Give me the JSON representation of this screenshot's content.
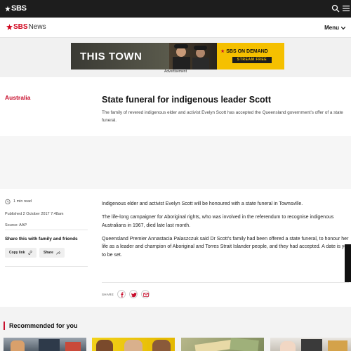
{
  "topbar": {
    "logo_text": "SBS",
    "icons": [
      "sbs-star-icon",
      "search-icon",
      "hamburger-icon"
    ]
  },
  "newsbar": {
    "logo_sbs": "SBS",
    "logo_news": "News",
    "menu_label": "Menu"
  },
  "advert": {
    "show_title": "THIS TOWN",
    "brand": "SBS ON DEMAND",
    "cta": "STREAM FREE",
    "label": "Advertisement",
    "colors": {
      "accent": "#f5c000"
    }
  },
  "article": {
    "category": "Australia",
    "headline": "State funeral for indigenous leader Scott",
    "standfirst": "The family of revered indigenous elder and activist Evelyn Scott has accepted the Queensland government's offer of a state funeral.",
    "read_time": "1 min read",
    "published": "Published 2 October 2017 7:48am",
    "source": "Source: AAP",
    "share_heading": "Share this with family and friends",
    "copy_link": "Copy link",
    "share": "Share",
    "paragraphs": [
      "Indigenous elder and activist Evelyn Scott will be honoured with a state funeral in Townsville.",
      "The life-long campaigner for Aboriginal rights, who was involved in the referendum to recognise indigenous Australians in 1967, died late last month.",
      "Queensland Premier Annastacia Palaszczuk said Dr Scott's family had been offered a state funeral, to honour her life as a leader and champion of Aboriginal and Torres Strait Islander people, and they had accepted. A date is yet to be set."
    ],
    "share_bar_label": "SHARE"
  },
  "recommended": {
    "title": "Recommended for you"
  },
  "colors": {
    "brand_red": "#c8102e",
    "dark": "#1d1d1d"
  }
}
